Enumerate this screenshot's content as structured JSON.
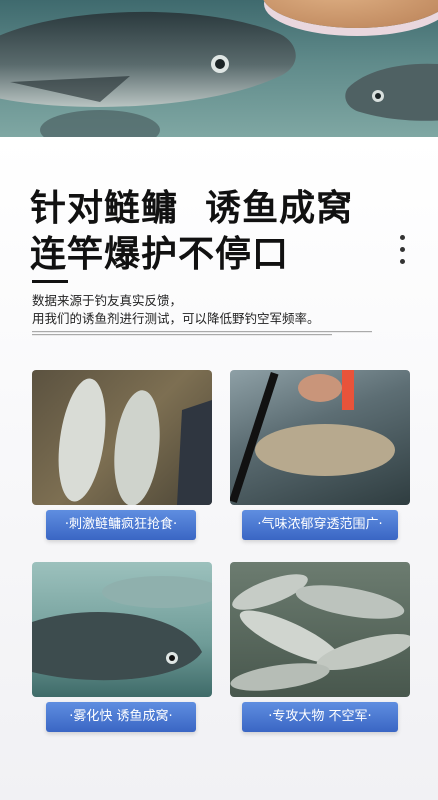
{
  "headline": {
    "line1": "针对鲢鳙  诱鱼成窝",
    "line2": "连竿爆护不停口"
  },
  "description": {
    "line1": "数据来源于钓友真实反馈，",
    "line2": "用我们的诱鱼剂进行测试，可以降低野钓空军频率。"
  },
  "features": [
    {
      "label": "·刺激鲢鳙疯狂抢食·"
    },
    {
      "label": "·气味浓郁穿透范围广·"
    },
    {
      "label": "·雾化快 诱鱼成窝·"
    },
    {
      "label": "·专攻大物 不空军·"
    }
  ],
  "colors": {
    "accent": "#3a66c4",
    "headline": "#111111"
  }
}
